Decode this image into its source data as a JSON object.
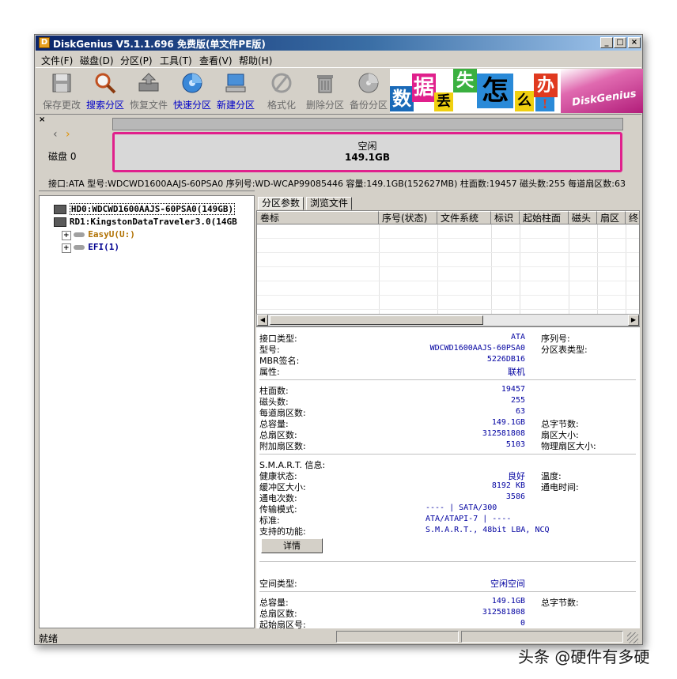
{
  "window": {
    "title": "DiskGenius V5.1.1.696 免费版(单文件PE版)",
    "icon": "diskgenius-app-icon",
    "controls": [
      "_",
      "□",
      "×"
    ]
  },
  "menu": [
    "文件(F)",
    "磁盘(D)",
    "分区(P)",
    "工具(T)",
    "查看(V)",
    "帮助(H)"
  ],
  "toolbar": [
    {
      "label": "保存更改",
      "icon": "save-icon",
      "enabled": false
    },
    {
      "label": "搜索分区",
      "icon": "search-magnifier-icon",
      "enabled": true
    },
    {
      "label": "恢复文件",
      "icon": "recover-file-icon",
      "enabled": false
    },
    {
      "label": "快速分区",
      "icon": "quick-partition-icon",
      "enabled": true
    },
    {
      "label": "新建分区",
      "icon": "new-partition-icon",
      "enabled": true
    },
    {
      "label": "格式化",
      "icon": "format-icon",
      "enabled": false
    },
    {
      "label": "删除分区",
      "icon": "delete-trash-icon",
      "enabled": false
    },
    {
      "label": "备份分区",
      "icon": "backup-disk-icon",
      "enabled": false
    }
  ],
  "banner": {
    "tiles": [
      "数",
      "据",
      "丢",
      "失",
      "怎",
      "么",
      "办",
      "!"
    ],
    "brand": "DiskGenius"
  },
  "disk_map": {
    "disk_label": "磁盘 0",
    "free_label": "空闲",
    "free_size": "149.1GB"
  },
  "disk_info_line": "接口:ATA  型号:WDCWD1600AAJS-60PSA0  序列号:WD-WCAP99085446  容量:149.1GB(152627MB)  柱面数:19457  磁头数:255  每道扇区数:63",
  "tree": {
    "close": "×",
    "items": [
      {
        "label": "HD0:WDCWD1600AAJS-60PSA0(149GB)",
        "level": 0,
        "selected": true
      },
      {
        "label": "RD1:KingstonDataTraveler3.0(14GB",
        "level": 0,
        "selected": false
      },
      {
        "label": "EasyU(U:)",
        "level": 1,
        "color": "#b07000"
      },
      {
        "label": "EFI(1)",
        "level": 1,
        "color": "#000090"
      }
    ]
  },
  "tabs": [
    "分区参数",
    "浏览文件"
  ],
  "table_headers": [
    "卷标",
    "序号(状态)",
    "文件系统",
    "标识",
    "起始柱面",
    "磁头",
    "扇区",
    "终"
  ],
  "details": {
    "g1": [
      [
        "接口类型:",
        "ATA"
      ],
      [
        "型号:",
        "WDCWD1600AAJS-60PSA0"
      ],
      [
        "MBR签名:",
        "5226DB16"
      ],
      [
        "属性:",
        "联机"
      ]
    ],
    "g1_right": [
      "序列号:",
      "分区表类型:"
    ],
    "g2": [
      [
        "柱面数:",
        "19457"
      ],
      [
        "磁头数:",
        "255"
      ],
      [
        "每道扇区数:",
        "63"
      ],
      [
        "总容量:",
        "149.1GB"
      ],
      [
        "总扇区数:",
        "312581808"
      ],
      [
        "附加扇区数:",
        "5103"
      ]
    ],
    "g2_right": [
      "总字节数:",
      "扇区大小:",
      "物理扇区大小:"
    ],
    "smart_title": "S.M.A.R.T. 信息:",
    "g3": [
      [
        "健康状态:",
        "良好"
      ],
      [
        "缓冲区大小:",
        "8192 KB"
      ],
      [
        "通电次数:",
        "3586"
      ]
    ],
    "g3_right": [
      "温度:",
      "通电时间:"
    ],
    "g3_left_vals": [
      [
        "传输模式:",
        "---- | SATA/300"
      ],
      [
        "标准:",
        "ATA/ATAPI-7 | ----"
      ],
      [
        "支持的功能:",
        "S.M.A.R.T., 48bit LBA, NCQ"
      ]
    ],
    "detail_button": "详情",
    "g4": [
      [
        "空间类型:",
        "空闲空间"
      ]
    ],
    "g5": [
      [
        "总容量:",
        "149.1GB"
      ],
      [
        "总扇区数:",
        "312581808"
      ],
      [
        "起始扇区号:",
        "0"
      ]
    ],
    "g5_right": [
      "总字节数:"
    ]
  },
  "status": "就绪",
  "watermark": "头条 @硬件有多硬"
}
